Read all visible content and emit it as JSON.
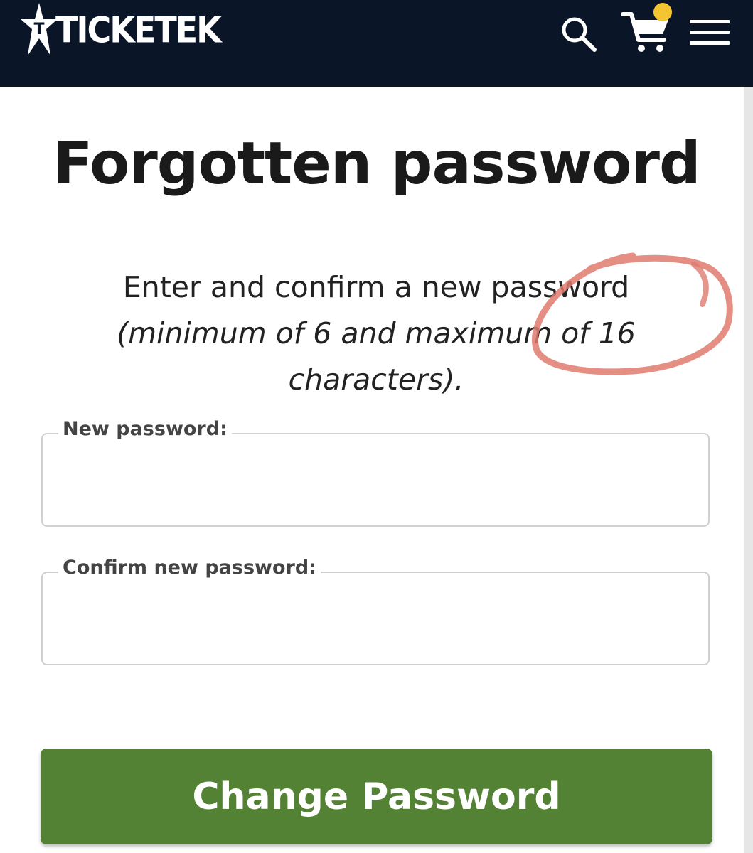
{
  "header": {
    "brand": "TICKETEK",
    "brand_mark": "T",
    "search_icon": "search-icon",
    "cart_icon": "cart-icon",
    "menu_icon": "hamburger-menu-icon",
    "cart_badge_color": "#f4c531",
    "background": "#0a1628"
  },
  "main": {
    "title": "Forgotten password",
    "instruction_line": "Enter and confirm a new password",
    "requirement": "(minimum of 6 and maximum of 16 characters).",
    "annotation": "red-hand-drawn-circle"
  },
  "form": {
    "new_password_label": "New password:",
    "new_password_value": "",
    "confirm_password_label": "Confirm new password:",
    "confirm_password_value": "",
    "submit_label": "Change Password",
    "submit_color": "#548235"
  }
}
